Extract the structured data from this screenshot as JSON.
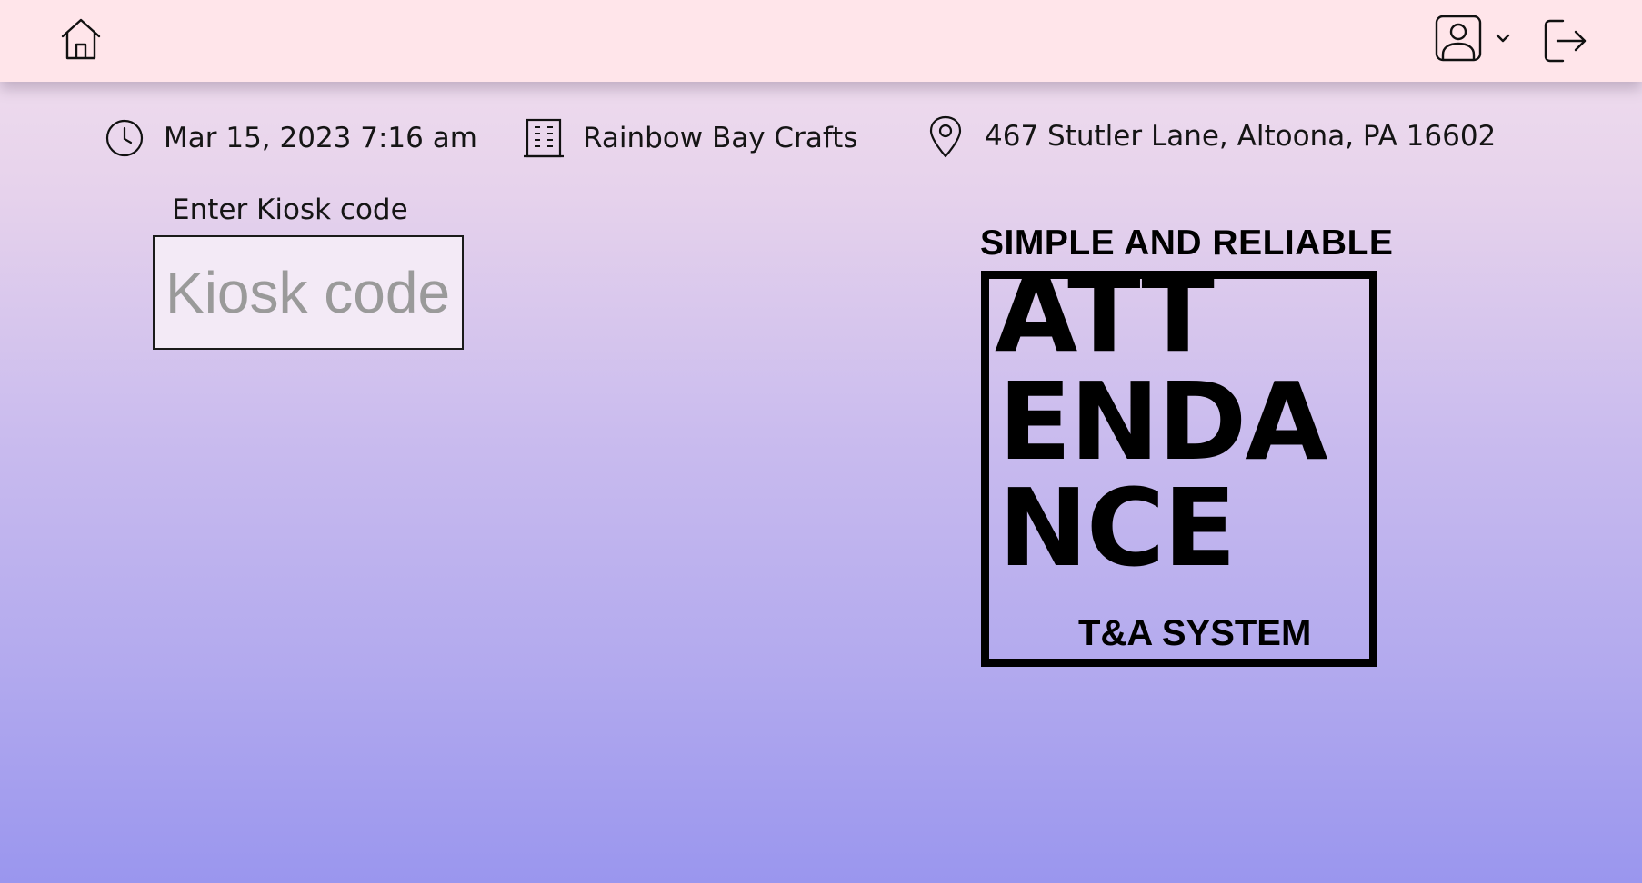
{
  "header": {
    "home_icon": "home-icon",
    "user_icon": "user-profile-icon",
    "dropdown_icon": "chevron-down-icon",
    "logout_icon": "logout-icon"
  },
  "info": {
    "datetime": "Mar 15, 2023 7:16 am",
    "company": "Rainbow Bay Crafts",
    "address": "467 Stutler Lane, Altoona, PA 16602"
  },
  "kiosk": {
    "label": "Enter Kiosk code",
    "placeholder": "Kiosk code",
    "value": ""
  },
  "logo": {
    "tagline": "SIMPLE AND RELIABLE",
    "line1": "ATT",
    "line2": "ENDA",
    "line3": "NCE",
    "subtitle": "T&A SYSTEM"
  },
  "colors": {
    "topbar": "#ffe5ea",
    "gradient_top": "#f3e1ee",
    "gradient_bottom": "#9a96ee"
  }
}
